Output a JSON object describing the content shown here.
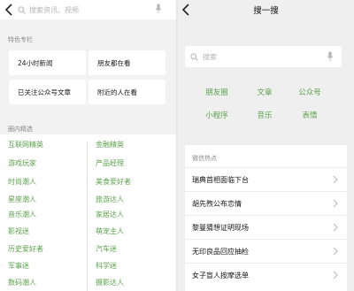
{
  "left": {
    "search_placeholder": "搜索资讯、视频",
    "features_title": "特色专栏",
    "features": [
      "24小时新闻",
      "朋友都在看",
      "已关注公众号文章",
      "附近的人在看"
    ],
    "interests_title": "圈内精选",
    "interests_left": [
      "互联网精英",
      "游戏玩家",
      "时尚潮人",
      "星座潮人",
      "音乐潮人",
      "影视迷",
      "历史爱好者",
      "军事迷",
      "数码潮人"
    ],
    "interests_right": [
      "金融精英",
      "产品经理",
      "美食爱好者",
      "旅游达人",
      "家居达人",
      "萌宠主人",
      "汽车迷",
      "科学迷",
      "摄影达人"
    ]
  },
  "right": {
    "title": "搜一搜",
    "search_placeholder": "搜索",
    "categories": [
      "朋友圈",
      "文章",
      "公众号",
      "小程序",
      "音乐",
      "表情"
    ],
    "hot_title": "微信热点",
    "hot_items": [
      "瑞典首相面临下台",
      "胡先煦公布恋情",
      "黎曼猜想证明现场",
      "无印良品回应抽检",
      "女子盲人按摩选单"
    ]
  },
  "colors": {
    "accent_green": "#5aa34a",
    "bg": "#efefef"
  }
}
